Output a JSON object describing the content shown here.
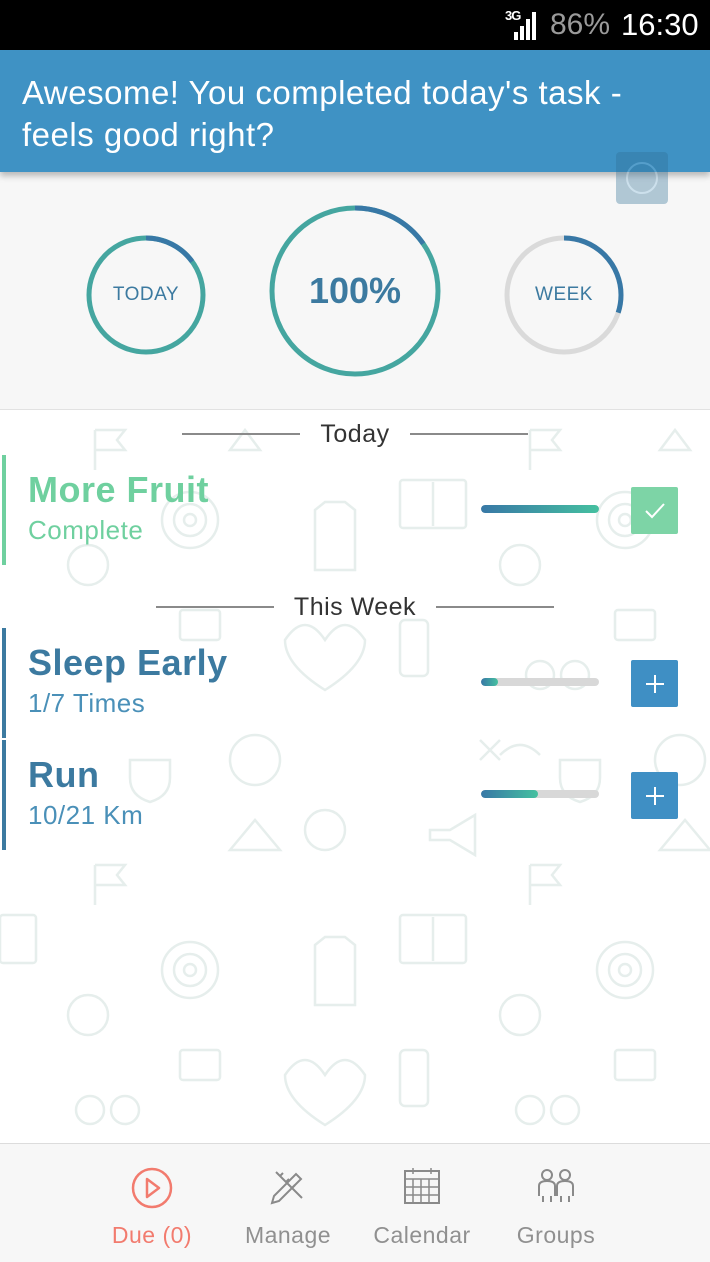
{
  "status_bar": {
    "network": "3G",
    "battery": "86%",
    "time": "16:30"
  },
  "banner": {
    "message": "Awesome! You completed today's task - feels good right?"
  },
  "stats": {
    "today": {
      "label": "TODAY",
      "progress": 0.15
    },
    "center": {
      "label": "100%",
      "progress": 1.0
    },
    "week": {
      "label": "WEEK",
      "progress": 0.3
    }
  },
  "sections": {
    "today": "Today",
    "this_week": "This Week"
  },
  "tasks": [
    {
      "title": "More Fruit",
      "subtitle": "Complete",
      "progress": 1.0,
      "status": "done",
      "color": "#6fd09f"
    },
    {
      "title": "Sleep Early",
      "subtitle": "1/7 Times",
      "progress": 0.14,
      "status": "add",
      "color": "#3c7aa0"
    },
    {
      "title": "Run",
      "subtitle": "10/21 Km",
      "progress": 0.48,
      "status": "add",
      "color": "#3c7aa0"
    }
  ],
  "icons": {
    "done": "check-icon",
    "add": "plus-icon"
  },
  "colors": {
    "banner": "#3f92c4",
    "accent_blue": "#3c7aa0",
    "accent_green": "#6fd09f",
    "active_nav": "#f27b6e"
  },
  "nav": [
    {
      "label": "Due (0)",
      "icon": "play-circle-icon",
      "active": true
    },
    {
      "label": "Manage",
      "icon": "pencil-ruler-icon",
      "active": false
    },
    {
      "label": "Calendar",
      "icon": "calendar-icon",
      "active": false
    },
    {
      "label": "Groups",
      "icon": "groups-icon",
      "active": false
    }
  ]
}
